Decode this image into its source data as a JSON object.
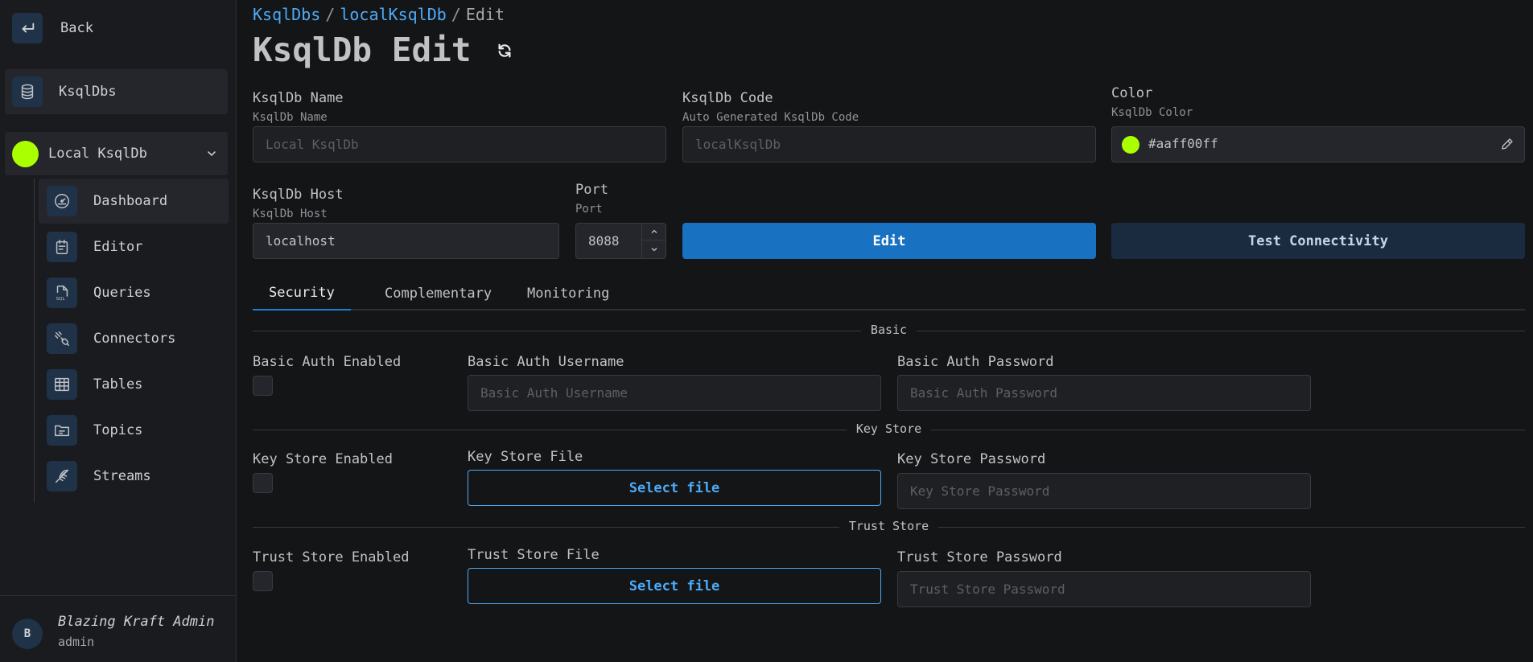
{
  "sidebar": {
    "back_label": "Back",
    "nav_ksqldbs": "KsqlDbs",
    "cluster": {
      "name": "Local KsqlDb",
      "color": "#aaff00"
    },
    "items": [
      {
        "label": "Dashboard",
        "icon": "gauge-icon",
        "active": true
      },
      {
        "label": "Editor",
        "icon": "calendar-editor-icon"
      },
      {
        "label": "Queries",
        "icon": "sql-file-icon"
      },
      {
        "label": "Connectors",
        "icon": "plug-icon"
      },
      {
        "label": "Tables",
        "icon": "table-icon"
      },
      {
        "label": "Topics",
        "icon": "folder-icon"
      },
      {
        "label": "Streams",
        "icon": "feather-icon"
      }
    ],
    "user": {
      "initial": "B",
      "name": "Blazing Kraft Admin",
      "role": "admin"
    }
  },
  "breadcrumb": {
    "root": "KsqlDbs",
    "item": "localKsqlDb",
    "current": "Edit",
    "sep": "/"
  },
  "page_title": "KsqlDb Edit",
  "form": {
    "name": {
      "label": "KsqlDb Name",
      "desc": "KsqlDb Name",
      "placeholder": "Local KsqlDb"
    },
    "code": {
      "label": "KsqlDb Code",
      "desc": "Auto Generated KsqlDb Code",
      "placeholder": "localKsqlDb"
    },
    "color": {
      "label": "Color",
      "desc": "KsqlDb Color",
      "value": "#aaff00ff"
    },
    "host": {
      "label": "KsqlDb Host",
      "desc": "KsqlDb Host",
      "value": "localhost"
    },
    "port": {
      "label": "Port",
      "desc": "Port",
      "value": "8088"
    },
    "edit_button": "Edit",
    "test_button": "Test Connectivity"
  },
  "tabs": [
    {
      "label": "Security",
      "active": true
    },
    {
      "label": "Complementary"
    },
    {
      "label": "Monitoring"
    }
  ],
  "security": {
    "basic": {
      "section": "Basic",
      "enabled_label": "Basic Auth Enabled",
      "username_label": "Basic Auth Username",
      "username_placeholder": "Basic Auth Username",
      "password_label": "Basic Auth Password",
      "password_placeholder": "Basic Auth Password"
    },
    "keystore": {
      "section": "Key Store",
      "enabled_label": "Key Store Enabled",
      "file_label": "Key Store File",
      "file_button": "Select file",
      "password_label": "Key Store Password",
      "password_placeholder": "Key Store Password"
    },
    "truststore": {
      "section": "Trust Store",
      "enabled_label": "Trust Store Enabled",
      "file_label": "Trust Store File",
      "file_button": "Select file",
      "password_label": "Trust Store Password",
      "password_placeholder": "Trust Store Password"
    }
  }
}
